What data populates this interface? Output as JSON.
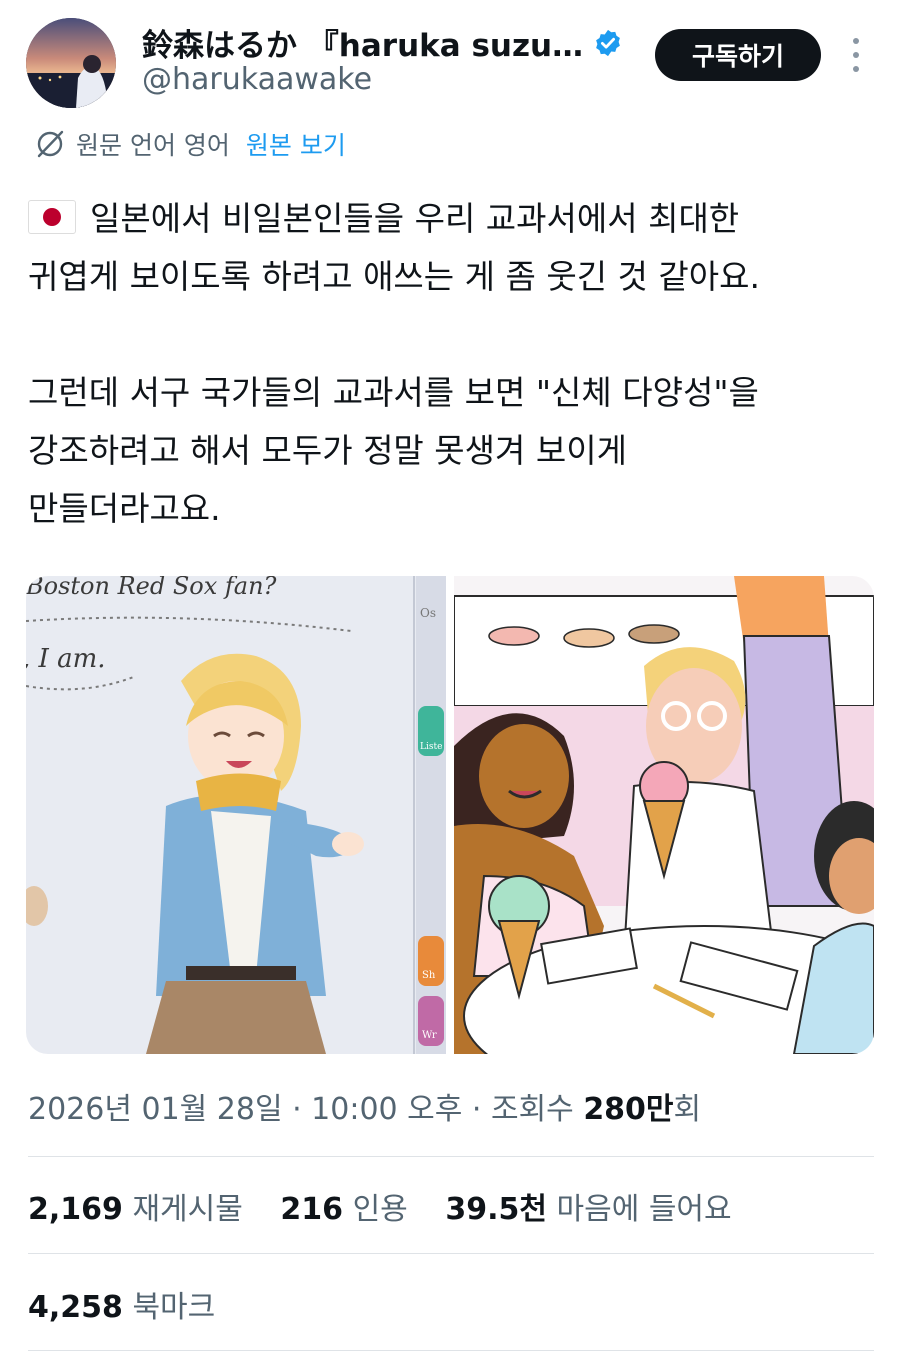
{
  "author": {
    "display_name": "鈴森はるか 『haruka suzu…",
    "handle": "@harukaawake",
    "verified": true
  },
  "header": {
    "subscribe_label": "구독하기"
  },
  "translation": {
    "original_language": "원문 언어 영어",
    "view_original_label": "원본 보기"
  },
  "tweet": {
    "flag_icon": "japan-flag-icon",
    "lines_paragraph1": [
      "일본에서 비일본인들을 우리 교과서에서 최대한",
      "귀엽게 보이도록 하려고 애쓰는 게 좀 웃긴 것 같아요."
    ],
    "lines_paragraph2": [
      "그런데 서구 국가들의 교과서를 보면 \"신체 다양성\"을",
      "강조하려고 해서 모두가 정말 못생겨 보이게",
      "만들더라고요."
    ]
  },
  "media": {
    "left_caption_1": "Boston Red Sox fan?",
    "left_caption_2": ", I am.",
    "left_side_label": "Os",
    "left_side_label_2": "Liste",
    "left_side_label_3": "Sh",
    "left_side_label_4": "Wr"
  },
  "meta": {
    "timestamp": "2026년 01월 28일 · 10:00 오후 · 조회수 ",
    "views_count": "280만",
    "views_suffix": "회"
  },
  "stats": {
    "reposts_count": "2,169",
    "reposts_label": "재게시물",
    "quotes_count": "216",
    "quotes_label": "인용",
    "likes_count": "39.5천",
    "likes_label": "마음에 들어요",
    "bookmarks_count": "4,258",
    "bookmarks_label": "북마크"
  },
  "colors": {
    "accent": "#1d9bf0",
    "text_primary": "#0f1419",
    "text_secondary": "#536471",
    "button_bg": "#0f1419"
  }
}
